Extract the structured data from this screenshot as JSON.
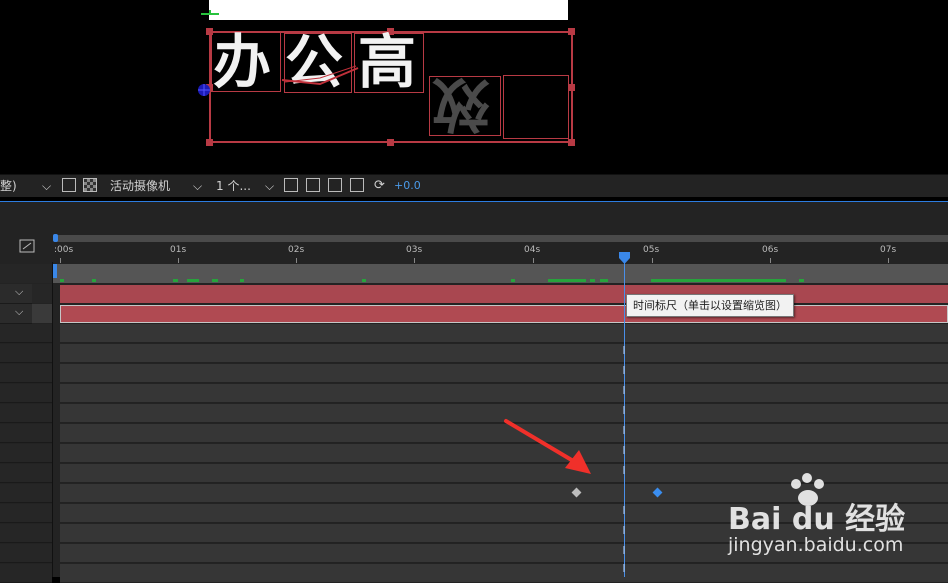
{
  "composition": {
    "glyphs": [
      "办",
      "公",
      "高",
      "效"
    ]
  },
  "toolbar": {
    "view_dropdown": "整)",
    "camera_dropdown": "活动摄像机",
    "views_dropdown": "1 个...",
    "exposure_value": "+0.0"
  },
  "timeline": {
    "ruler_labels": [
      ":00s",
      "01s",
      "02s",
      "03s",
      "04s",
      "05s",
      "06s",
      "07s"
    ],
    "tooltip": "时间标尺（单击以设置缩览图）",
    "colors": {
      "accent": "#2d7de0",
      "layer_bar": "#b04a52",
      "track": "#363636"
    }
  },
  "watermark": {
    "brand": "Bai du 经验",
    "url": "jingyan.baidu.com"
  }
}
